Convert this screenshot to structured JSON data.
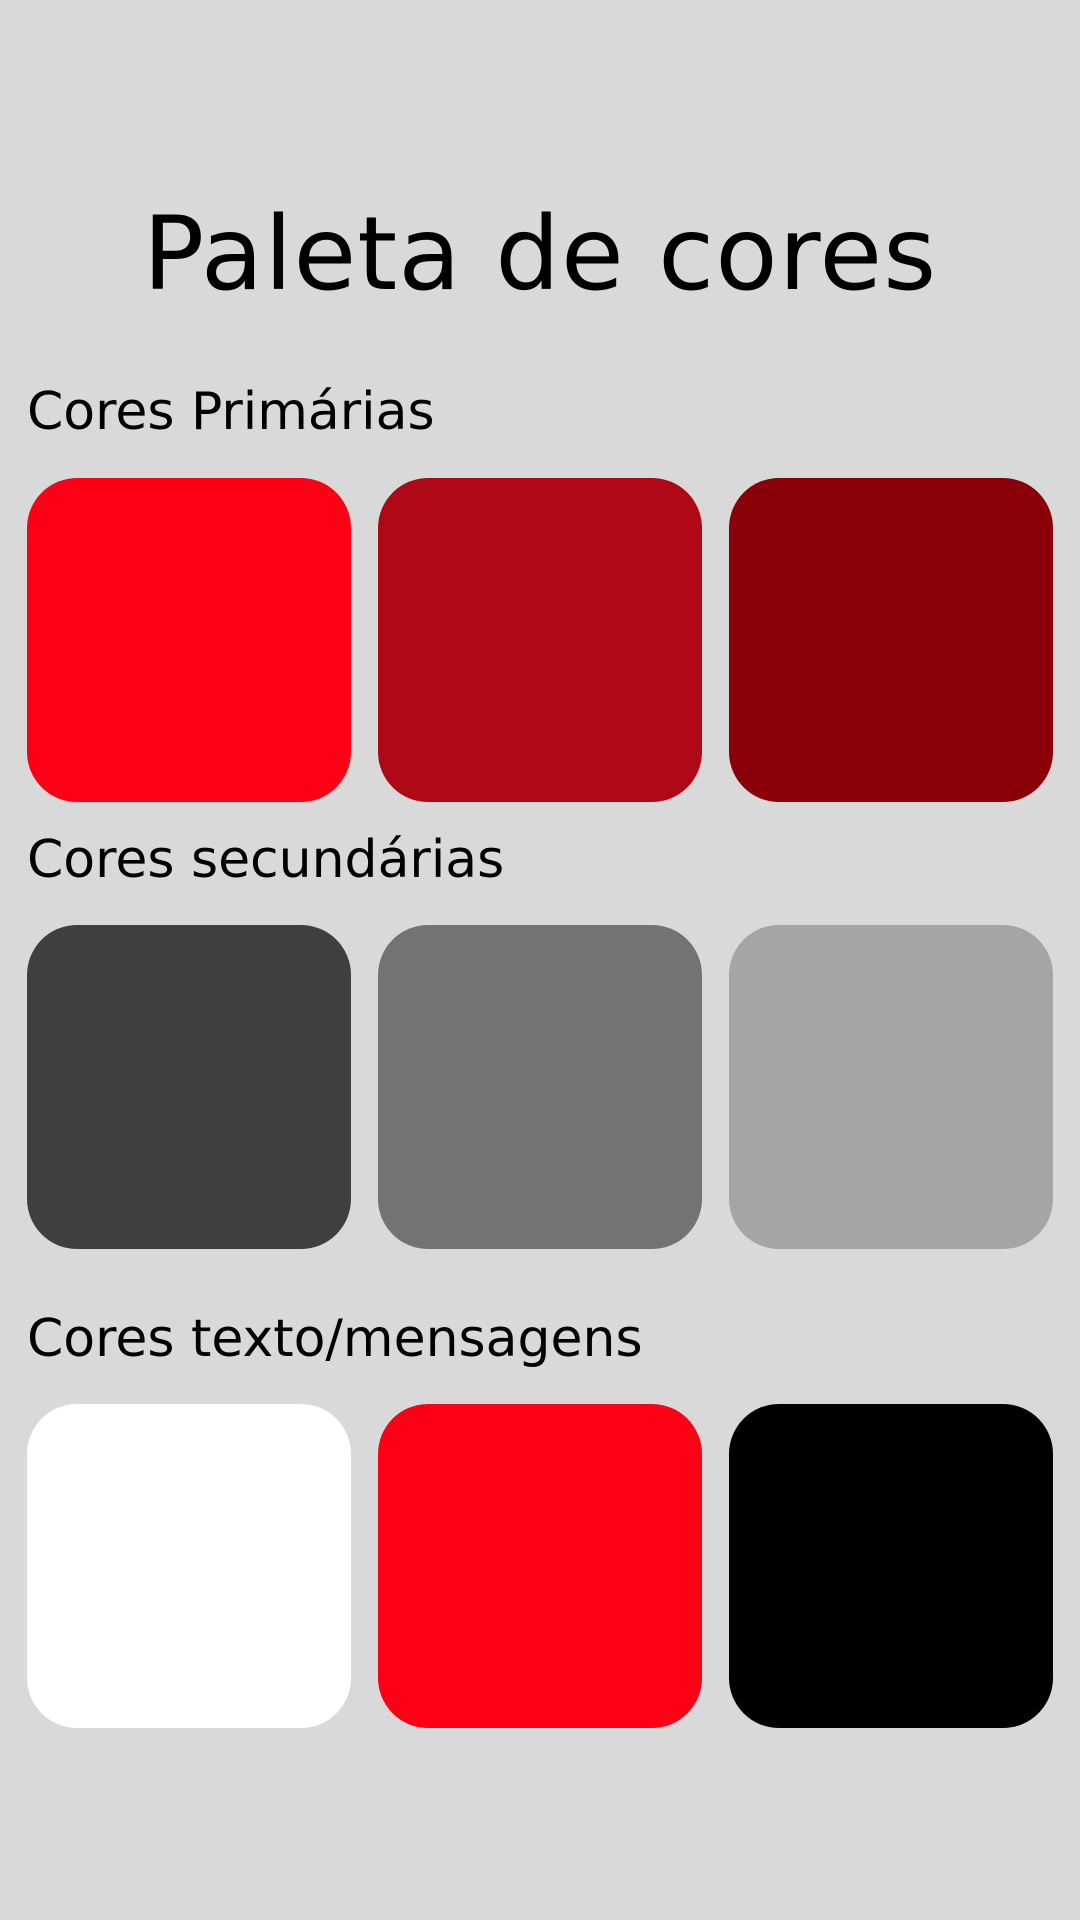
{
  "title": "Paleta de cores",
  "sections": [
    {
      "title": "Cores Primárias",
      "swatches": [
        "#fd0016",
        "#ae0715",
        "#890009"
      ]
    },
    {
      "title": "Cores secundárias",
      "swatches": [
        "#3f3f3f",
        "#737373",
        "#a5a5a5"
      ]
    },
    {
      "title": "Cores texto/mensagens",
      "swatches": [
        "#ffffff",
        "#fd0016",
        "#000000"
      ]
    }
  ],
  "colors": {
    "background": "#d9d9d9",
    "text": "#000000"
  }
}
